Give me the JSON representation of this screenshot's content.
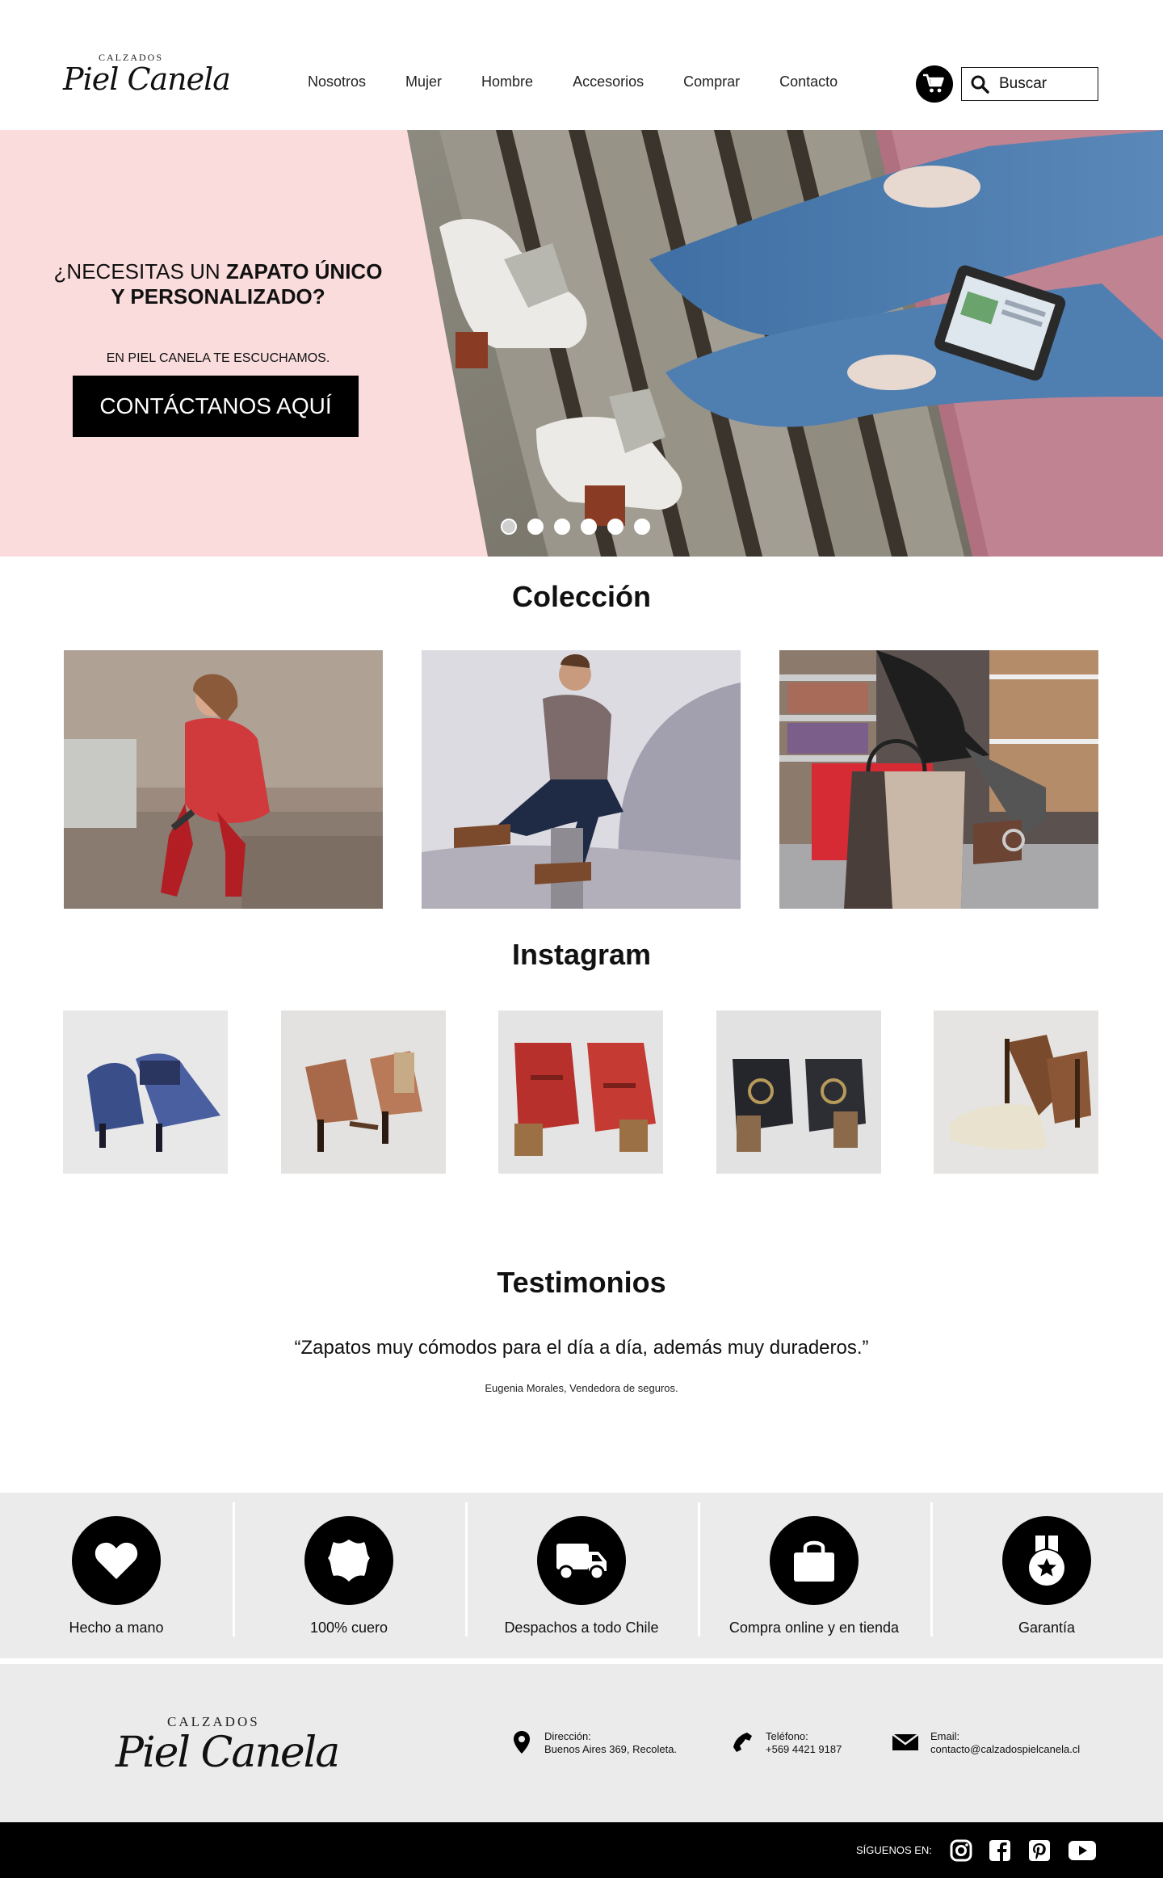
{
  "header": {
    "logo_small": "CALZADOS",
    "logo_script": "Piel Canela",
    "nav": [
      "Nosotros",
      "Mujer",
      "Hombre",
      "Accesorios",
      "Comprar",
      "Contacto"
    ],
    "search_placeholder": "Buscar",
    "cart_icon": "cart-icon",
    "search_icon": "search-icon"
  },
  "hero": {
    "title_normal": "¿NECESITAS UN ",
    "title_bold_1": "ZAPATO ÚNICO",
    "title_bold_2": "Y PERSONALIZADO?",
    "subtitle": "EN PIEL CANELA TE ESCUCHAMOS.",
    "cta": "CONTÁCTANOS AQUÍ",
    "slides_total": 6,
    "active_slide": 1
  },
  "collection": {
    "title": "Colección"
  },
  "instagram": {
    "title": "Instagram"
  },
  "testimonials": {
    "title": "Testimonios",
    "quote": "“Zapatos muy cómodos para el día a día, además muy duraderos.”",
    "author": "Eugenia Morales, Vendedora de seguros."
  },
  "features": [
    {
      "label": "Hecho a mano",
      "icon": "heart-icon"
    },
    {
      "label": "100% cuero",
      "icon": "leather-icon"
    },
    {
      "label": "Despachos a todo Chile",
      "icon": "truck-icon"
    },
    {
      "label": "Compra online y en tienda",
      "icon": "shopping-bag-icon"
    },
    {
      "label": "Garantía",
      "icon": "medal-icon"
    }
  ],
  "footer": {
    "logo_small": "CALZADOS",
    "logo_script": "Piel Canela",
    "address_label": "Dirección:",
    "address_value": "Buenos Aires 369, Recoleta.",
    "phone_label": "Teléfono:",
    "phone_value": "+569 4421 9187",
    "email_label": "Email:",
    "email_value": "contacto@calzadospielcanela.cl"
  },
  "social": {
    "label": "SÍGUENOS EN:",
    "icons": [
      "instagram-icon",
      "facebook-icon",
      "pinterest-icon",
      "youtube-icon"
    ]
  },
  "colors": {
    "hero_bg": "#fbdcdc",
    "feature_bg": "#ebebeb",
    "black": "#000000"
  }
}
